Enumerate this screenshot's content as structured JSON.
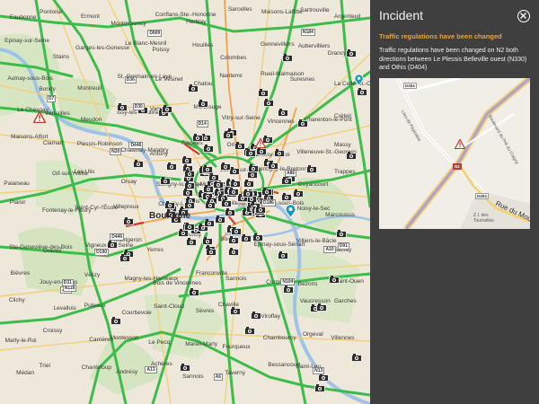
{
  "panel": {
    "title": "Incident",
    "subtitle": "Traffic regulations have been changed",
    "description": "Traffic regulations have been changed on N2 both directions between Le Plessis Belleville ouest (N330) and Othis (D404)",
    "close_icon": "close-circle-icon",
    "inset": {
      "road_labels": [
        "D404",
        "N2",
        "D404"
      ],
      "street_labels": [
        "Boulevard du Pré du Coigny",
        "Lieu-dit Pépinière",
        "Rue du Mout",
        "Z.I. des Tournelles"
      ]
    }
  },
  "map": {
    "places_large": [
      "Boulogne"
    ],
    "places": [
      "Eaubonne",
      "Pontoise",
      "Ermont",
      "Montmorency",
      "Conflans-Ste.-Honorine",
      "Herblay",
      "Sarcelles",
      "Maisons-Laffitte",
      "Sartrouville",
      "Argenteuil",
      "Epinay-sur-Seine",
      "Stains",
      "Garges-les-Gonesse",
      "Le Blanc-Mesnil",
      "Poissy",
      "Houilles",
      "Colombes",
      "Gennevilliers",
      "Aubervilliers",
      "Drancy",
      "Aulnay-sous-Bois",
      "Bondy",
      "Montreuil",
      "St.-Germain-en-Laye",
      "Le Vésinet",
      "Chatou",
      "Nanterre",
      "Rueil-Malmaison",
      "Suresnes",
      "La Celle-St.-Cloud",
      "Le Chesnay",
      "Versailles",
      "Meudon",
      "Issy-les-Moulineaux",
      "Vanves",
      "Montrouge",
      "Vitry-sur-Seine",
      "Vincennes",
      "Charenton-le-Pont",
      "Créteil",
      "Maisons-Alfort",
      "Clamart",
      "Plessis-Robinson",
      "Châtenay-Malabry",
      "Antony",
      "Fresnes",
      "Orly",
      "Choisy-le-Roi",
      "Villeneuve-St.-Georges",
      "Massy",
      "Palaiseau",
      "Gif-sur-Yvette",
      "Les Ulis",
      "Orsay",
      "Savigny-sur-Orge",
      "Athis-Mons",
      "Juvisy-sur-Orge",
      "Montigny-le-Bretonneux",
      "Guyancourt",
      "Trappes",
      "Plaisir",
      "Fontenay-le-Fleury",
      "Saint-Cyr-l'École",
      "Villepreux",
      "Chevilly-Larue",
      "Thiais",
      "Villejuif",
      "Rosny-sous-Bois",
      "Noisy-le-Sec",
      "Marcoussis",
      "Ste-Geneviève-des-Bois",
      "Draveil",
      "Vigneux-sur-Seine",
      "Montgeron",
      "Yerres",
      "Brunoy",
      "Boussy",
      "Épinay-sous-Sénart",
      "Villiers-le-Bâcle",
      "Saclay",
      "Bièvres",
      "Jouy-en-Josas",
      "Vélizy",
      "Magny-les-Hameaux",
      "Bois de Vincennes",
      "Franconville",
      "Sannois",
      "Cormeilles",
      "Bezons",
      "Saint-Ouen",
      "Clichy",
      "Levallois",
      "Puteaux",
      "Courbevoie",
      "Saint-Cloud",
      "Sèvres",
      "Chaville",
      "Viroflay",
      "Vaucresson",
      "Garches",
      "Marly-le-Roi",
      "Croissy",
      "Carrières",
      "Montesson",
      "Le Pecq",
      "Mareil-Marly",
      "Fourqueux",
      "Chambourcy",
      "Orgeval",
      "Villennes",
      "Médan",
      "Triel",
      "Chanteloup",
      "Andrésy",
      "Achères",
      "Sannois",
      "Taverny",
      "Bessancourt",
      "Saint-Leu"
    ],
    "route_labels": [
      "D909",
      "A15",
      "N184",
      "D14",
      "D30",
      "D186",
      "D190",
      "N13",
      "A13",
      "A86",
      "D7",
      "N118",
      "A6",
      "N20",
      "D36",
      "A10",
      "N104",
      "D446",
      "D31",
      "D91",
      "D446"
    ],
    "incident_marker": "warning-triangle-icon",
    "info_marker": "blue-info-marker-icon"
  }
}
